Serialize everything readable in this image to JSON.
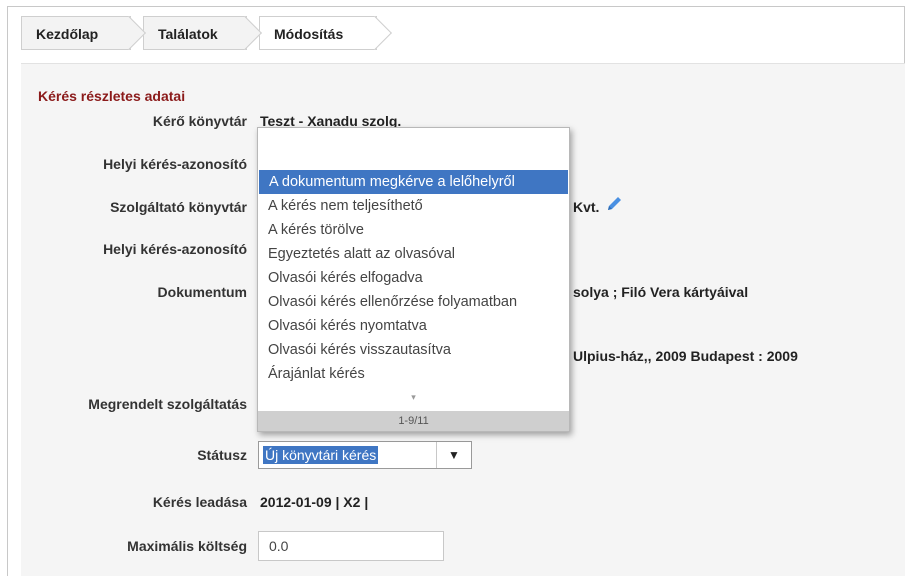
{
  "breadcrumb": {
    "items": [
      "Kezdőlap",
      "Találatok",
      "Módosítás"
    ]
  },
  "section_title": "Kérés részletes adatai",
  "fields": {
    "requester_library": {
      "label": "Kérő könyvtár",
      "value": "Teszt - Xanadu szolg."
    },
    "local_request_id_1": {
      "label": "Helyi kérés-azonosító"
    },
    "provider_library": {
      "label": "Szolgáltató könyvtár",
      "value": "Kvt."
    },
    "local_request_id_2": {
      "label": "Helyi kérés-azonosító"
    },
    "document": {
      "label": "Dokumentum",
      "value": "solya ; Filó Vera kártyáival",
      "value2": "Ulpius-ház,, 2009 Budapest : 2009"
    },
    "ordered_service": {
      "label": "Megrendelt szolgáltatás"
    },
    "status": {
      "label": "Státusz",
      "value": "Új könyvtári kérés"
    },
    "request_submitted": {
      "label": "Kérés leadása",
      "value": "2012-01-09 | X2 |"
    },
    "max_cost": {
      "label": "Maximális költség",
      "value": "0.0"
    }
  },
  "dropdown": {
    "search_value": "",
    "options": [
      "A dokumentum megkérve a lelőhelyről",
      "A kérés nem teljesíthető",
      "A kérés törölve",
      "Egyeztetés alatt az olvasóval",
      "Olvasói kérés elfogadva",
      "Olvasói kérés ellenőrzése folyamatban",
      "Olvasói kérés nyomtatva",
      "Olvasói kérés visszautasítva",
      "Árajánlat kérés"
    ],
    "active_index": 0,
    "more_indicator": "▾",
    "paging": "1-9/11"
  },
  "icons": {
    "pencil": "pencil-icon",
    "select_arrow": "▼"
  },
  "colors": {
    "section_title": "#8b1a1a",
    "selection": "#3f76c3",
    "pencil": "#4a90e2"
  }
}
